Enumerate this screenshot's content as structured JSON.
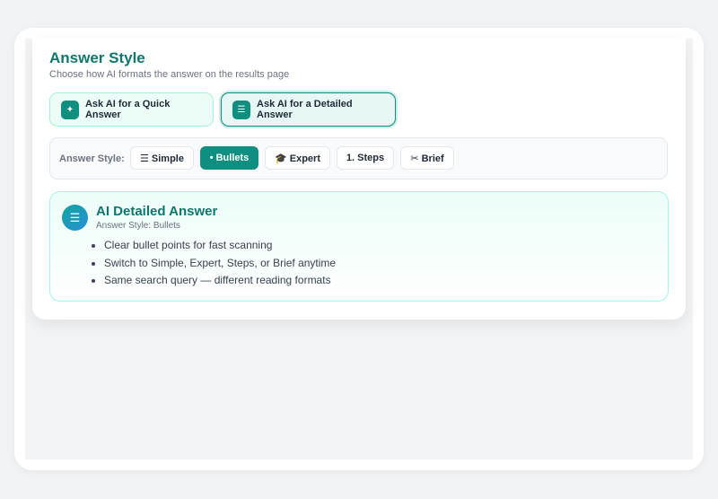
{
  "header": {
    "title": "Answer Style",
    "subtitle": "Choose how AI formats the answer on the results page"
  },
  "ask_buttons": {
    "quick": {
      "icon": "sparkle-icon",
      "glyph": "✦",
      "label": "Ask AI for a Quick Answer"
    },
    "detailed": {
      "icon": "list-icon",
      "glyph": "☰",
      "label": "Ask AI for a Detailed Answer",
      "selected": true
    }
  },
  "style_bar": {
    "label": "Answer Style:",
    "options": [
      {
        "label": "☰ Simple",
        "active": false
      },
      {
        "label": "• Bullets",
        "active": true
      },
      {
        "label": "🎓 Expert",
        "active": false
      },
      {
        "label": "1. Steps",
        "active": false
      },
      {
        "label": "✂ Brief",
        "active": false
      }
    ]
  },
  "answer": {
    "icon": "list-icon",
    "glyph": "☰",
    "title": "AI Detailed Answer",
    "subtitle": "Answer Style: Bullets",
    "items": [
      "Clear bullet points for fast scanning",
      "Switch to Simple, Expert, Steps, or Brief anytime",
      "Same search query — different reading formats"
    ]
  },
  "colors": {
    "accent": "#0f8f7f",
    "title": "#0f766e",
    "page_bg": "#f2f3f5"
  }
}
